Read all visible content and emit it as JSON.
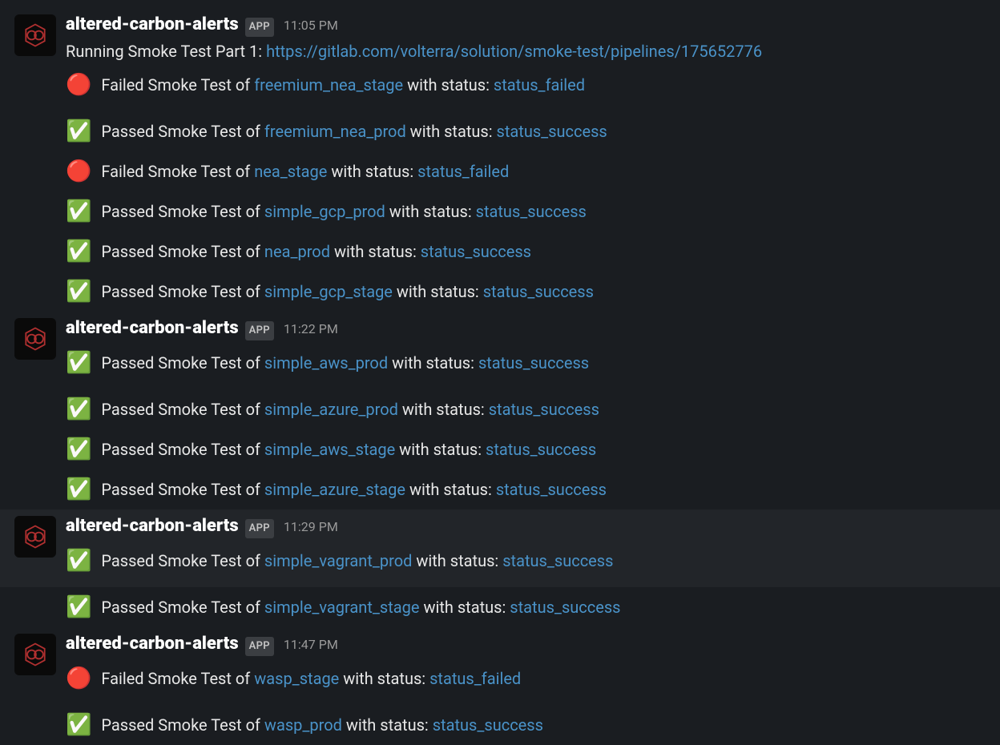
{
  "sender_name": "altered-carbon-alerts",
  "app_badge": "APP",
  "pipeline_url": "https://gitlab.com/volterra/solution/smoke-test/pipelines/175652776",
  "intro_prefix": "Running Smoke Test Part 1: ",
  "with_status_text": " with status: ",
  "passed_prefix": "Passed Smoke Test of ",
  "failed_prefix": "Failed Smoke Test of ",
  "emoji_pass": "✅",
  "emoji_fail": "🔴",
  "messages": [
    {
      "timestamp": "11:05 PM",
      "has_intro": true,
      "highlighted": false,
      "tests": [
        {
          "pass": false,
          "target": "freemium_nea_stage",
          "status": "status_failed"
        },
        {
          "pass": true,
          "target": "freemium_nea_prod",
          "status": "status_success"
        },
        {
          "pass": false,
          "target": "nea_stage",
          "status": "status_failed"
        },
        {
          "pass": true,
          "target": "simple_gcp_prod",
          "status": "status_success"
        },
        {
          "pass": true,
          "target": "nea_prod",
          "status": "status_success"
        },
        {
          "pass": true,
          "target": "simple_gcp_stage",
          "status": "status_success"
        }
      ]
    },
    {
      "timestamp": "11:22 PM",
      "has_intro": false,
      "highlighted": false,
      "tests": [
        {
          "pass": true,
          "target": "simple_aws_prod",
          "status": "status_success"
        },
        {
          "pass": true,
          "target": "simple_azure_prod",
          "status": "status_success"
        },
        {
          "pass": true,
          "target": "simple_aws_stage",
          "status": "status_success"
        },
        {
          "pass": true,
          "target": "simple_azure_stage",
          "status": "status_success"
        }
      ]
    },
    {
      "timestamp": "11:29 PM",
      "has_intro": false,
      "highlighted": true,
      "tests": [
        {
          "pass": true,
          "target": "simple_vagrant_prod",
          "status": "status_success"
        },
        {
          "pass": true,
          "target": "simple_vagrant_stage",
          "status": "status_success"
        }
      ]
    },
    {
      "timestamp": "11:47 PM",
      "has_intro": false,
      "highlighted": false,
      "tests": [
        {
          "pass": false,
          "target": "wasp_stage",
          "status": "status_failed"
        },
        {
          "pass": true,
          "target": "wasp_prod",
          "status": "status_success"
        }
      ]
    }
  ]
}
